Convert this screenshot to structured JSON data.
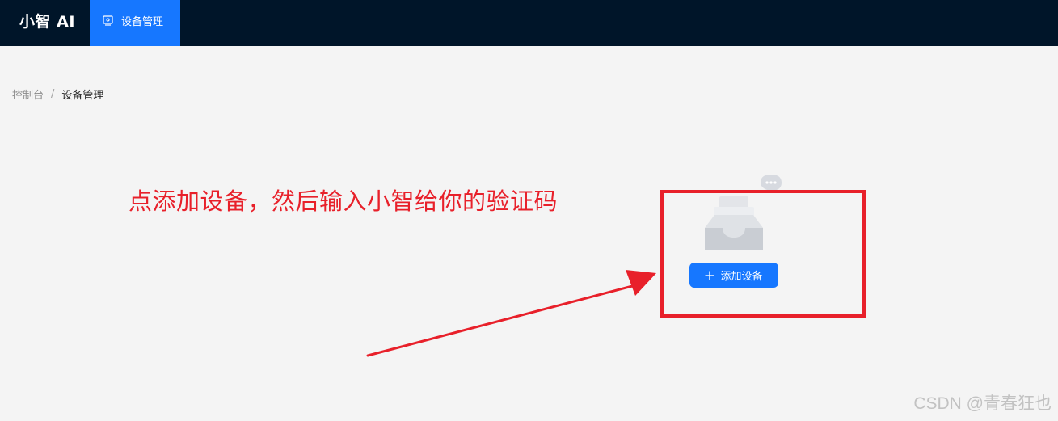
{
  "header": {
    "brand": "小智 AI",
    "nav": {
      "label": "设备管理",
      "icon": "device-icon"
    }
  },
  "breadcrumb": {
    "items": [
      "控制台",
      "设备管理"
    ],
    "separator": "/"
  },
  "annotation": {
    "text": "点添加设备，然后输入小智给你的验证码",
    "color": "#e8202a"
  },
  "empty_state": {
    "icon": "empty-inbox-icon",
    "more_icon": "more-dots-icon",
    "button_label": "添加设备",
    "button_icon": "plus-icon"
  },
  "watermark": "CSDN @青春狂也",
  "colors": {
    "header_bg": "#001529",
    "primary": "#1677ff",
    "page_bg": "#f4f4f4",
    "annotation_red": "#e8202a"
  }
}
